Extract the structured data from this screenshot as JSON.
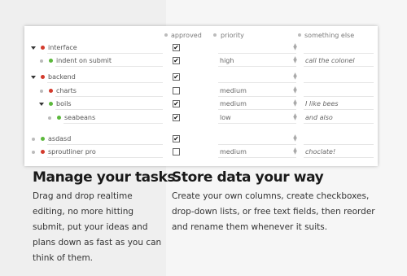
{
  "columns": {
    "approved": "approved",
    "priority": "priority",
    "something_else": "something else"
  },
  "rows": [
    {
      "label": "interface",
      "indent": 0,
      "expanded": true,
      "bullet": "red",
      "approved": true,
      "priority": "",
      "note": ""
    },
    {
      "label": "indent on submit",
      "indent": 1,
      "expanded": false,
      "bullet": "green",
      "approved": true,
      "priority": "high",
      "note": "call the colonel"
    },
    {
      "label": "backend",
      "indent": 0,
      "expanded": true,
      "bullet": "red",
      "approved": true,
      "priority": "",
      "note": ""
    },
    {
      "label": "charts",
      "indent": 1,
      "expanded": false,
      "bullet": "red",
      "approved": false,
      "priority": "medium",
      "note": ""
    },
    {
      "label": "boils",
      "indent": 1,
      "expanded": true,
      "bullet": "green",
      "approved": true,
      "priority": "medium",
      "note": "I like bees"
    },
    {
      "label": "seabeans",
      "indent": 2,
      "expanded": false,
      "bullet": "green",
      "approved": true,
      "priority": "low",
      "note": "and also"
    },
    {
      "label": "asdasd",
      "indent": 0,
      "expanded": false,
      "bullet": "green",
      "approved": true,
      "priority": "",
      "note": ""
    },
    {
      "label": "sproutliner pro",
      "indent": 0,
      "expanded": false,
      "bullet": "red",
      "approved": false,
      "priority": "medium",
      "note": "choclate!"
    }
  ],
  "left": {
    "heading": "Manage your tasks",
    "text": "Drag and drop realtime editing, no more hitting submit, put your ideas and plans down as fast as you can think of them."
  },
  "right": {
    "heading": "Store data your way",
    "text": "Create your own columns, create checkboxes, drop-down lists, or free text fields, then reorder and rename them whenever it suits."
  },
  "colors": {
    "red_bullet": "#d33a2c",
    "green_bullet": "#5cb83c",
    "left_bg": "#efefef",
    "right_bg": "#f6f6f6"
  }
}
